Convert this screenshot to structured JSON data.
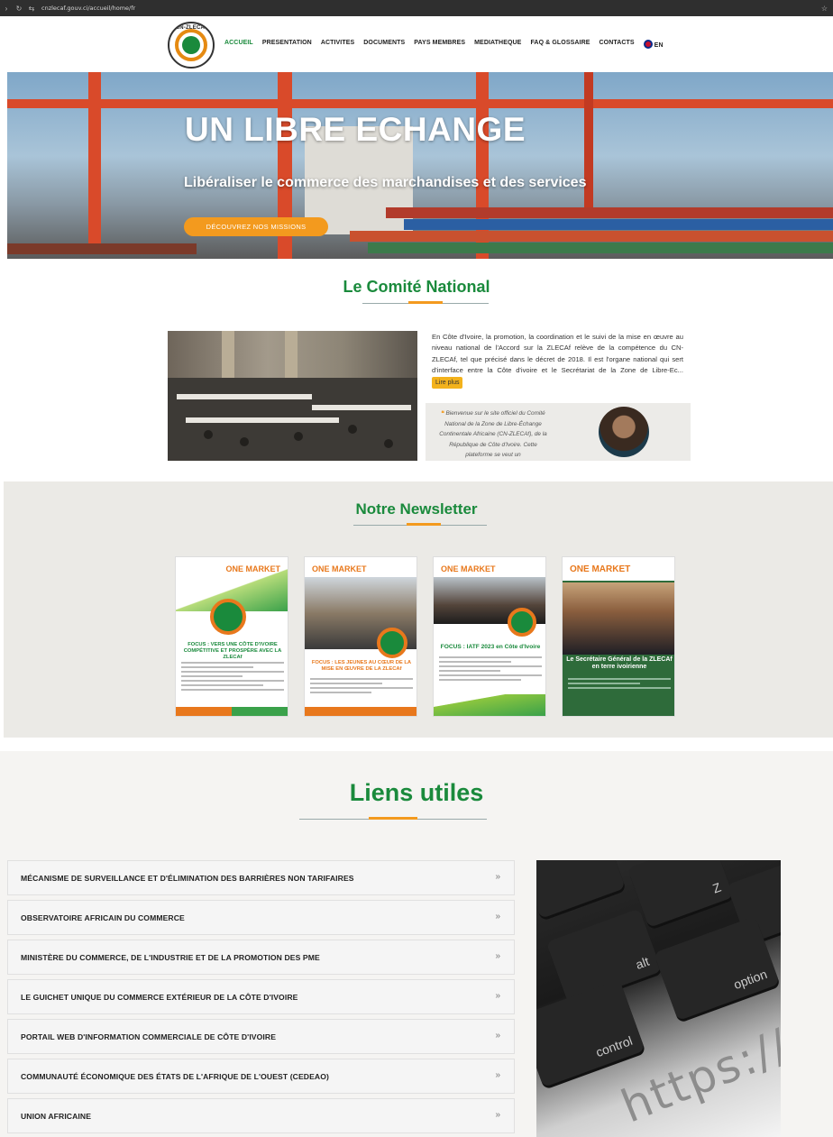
{
  "browser": {
    "url": "cnzlecaf.gouv.ci/accueil/home/fr"
  },
  "header": {
    "logo_text": "CN-ZLECAf",
    "nav": [
      {
        "label": "ACCUEIL",
        "active": true
      },
      {
        "label": "PRESENTATION",
        "active": false
      },
      {
        "label": "ACTIVITES",
        "active": false
      },
      {
        "label": "DOCUMENTS",
        "active": false
      },
      {
        "label": "PAYS MEMBRES",
        "active": false
      },
      {
        "label": "MEDIATHEQUE",
        "active": false
      },
      {
        "label": "FAQ & GLOSSAIRE",
        "active": false
      },
      {
        "label": "CONTACTS",
        "active": false
      }
    ],
    "lang": "EN"
  },
  "hero": {
    "title": "UN LIBRE ECHANGE",
    "subtitle": "Libéraliser le commerce des marchandises et des services",
    "button": "DÉCOUVREZ NOS MISSIONS"
  },
  "comite": {
    "title": "Le Comité National",
    "text": "En Côte d'Ivoire, la promotion, la coordination et le suivi de la mise en œuvre au niveau national de l'Accord sur la ZLECAf relève de la compétence du CN-ZLECAf, tel que précisé dans le décret de 2018. Il est l'organe national qui sert d'interface entre la Côte d'ivoire et le Secrétariat de la Zone de Libre-Ec...",
    "read_more": "Lire plus",
    "quote_mark": "❝",
    "quote": "Bienvenue sur le site officiel du Comité National de la Zone de Libre-Échange Continentale Africaine (CN-ZLECAf), de la République de Côte d'Ivoire. Cette plateforme se veut un"
  },
  "newsletter": {
    "title": "Notre Newsletter",
    "issues": [
      {
        "brand": "ONE MARKET",
        "headline": "FOCUS : VERS UNE CÔTE D'IVOIRE COMPÉTITIVE ET PROSPÈRE AVEC LA ZLECAf"
      },
      {
        "brand": "ONE MARKET",
        "headline": "FOCUS : LES JEUNES AU CŒUR DE LA MISE EN ŒUVRE DE LA ZLECAf"
      },
      {
        "brand": "ONE MARKET",
        "headline": "FOCUS : IATF 2023 en Côte d'Ivoire"
      },
      {
        "brand": "ONE MARKET",
        "headline": "Le Secrétaire Général de la ZLECAf en terre ivoirienne"
      }
    ]
  },
  "links": {
    "title": "Liens utiles",
    "chevron": "»",
    "items": [
      "MÉCANISME DE SURVEILLANCE ET D'ÉLIMINATION DES BARRIÈRES NON TARIFAIRES",
      "OBSERVATOIRE AFRICAIN DU COMMERCE",
      "MINISTÈRE DU COMMERCE, DE L'INDUSTRIE ET DE LA PROMOTION DES PME",
      "LE GUICHET UNIQUE DU COMMERCE EXTÉRIEUR DE LA CÔTE D'IVOIRE",
      "PORTAIL WEB D'INFORMATION COMMERCIALE DE CÔTE D'IVOIRE",
      "COMMUNAUTÉ ÉCONOMIQUE DES ÉTATS DE L'AFRIQUE DE L'OUEST (CEDEAO)",
      "UNION AFRICAINE"
    ],
    "image_text": "https://",
    "key_labels": [
      "Z",
      "alt",
      "option",
      "control"
    ]
  }
}
